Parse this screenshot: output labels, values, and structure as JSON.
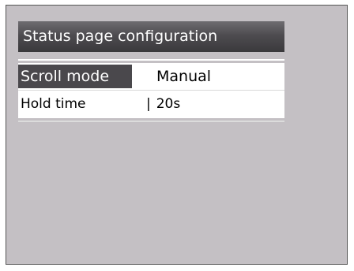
{
  "screen": {
    "title": "Status page configuration",
    "menu": {
      "items": [
        {
          "label": "Scroll mode",
          "value": "Manual",
          "selected": true
        },
        {
          "label": "Hold time",
          "separator": "|",
          "value": "20s",
          "selected": false
        }
      ]
    }
  },
  "colors": {
    "screen_background": "#c4c0c4",
    "title_bar": "#4e4c50",
    "selection": "#4a484c",
    "menu_background": "#ffffff"
  }
}
